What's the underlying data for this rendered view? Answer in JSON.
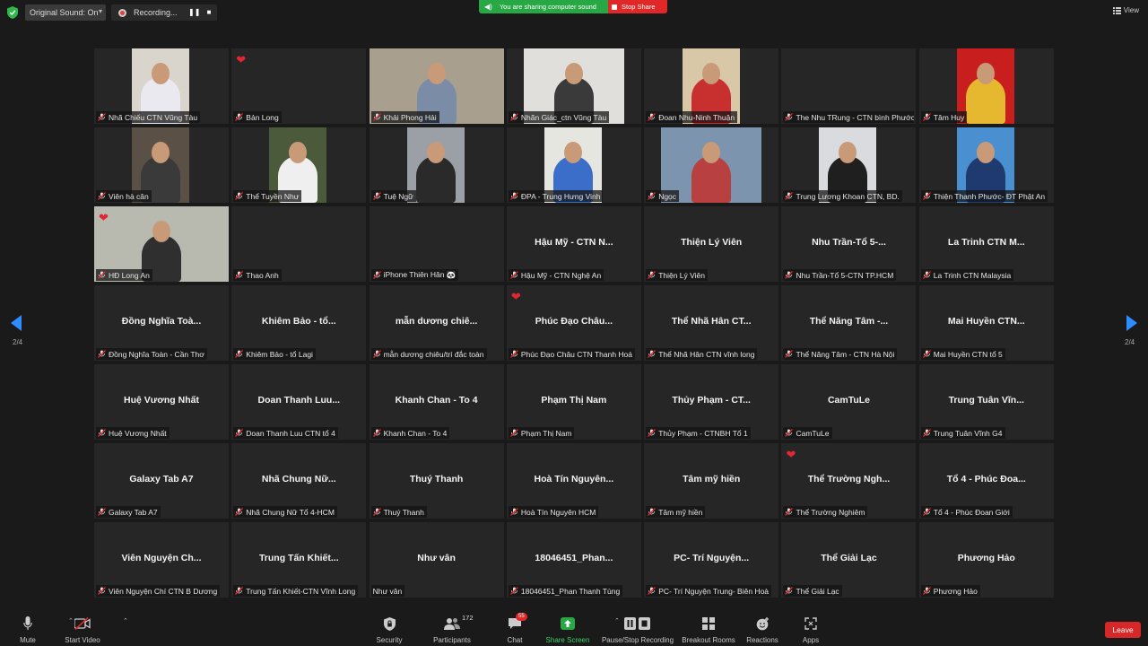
{
  "topbar": {
    "original_sound": "Original Sound: On",
    "recording": "Recording...",
    "sharing_banner": "You are sharing computer sound",
    "stop_share": "Stop Share",
    "view": "View"
  },
  "nav": {
    "page": "2/4"
  },
  "colors": {
    "accent_green": "#28a745",
    "danger_red": "#e02828",
    "heart": "#e32636",
    "tile_bg": "#262626"
  },
  "tiles": [
    {
      "label": "Nhã Chiếu CTN Vũng Tàu",
      "video": true,
      "vx": 42,
      "vw": 64,
      "bg": "#d9d4cc",
      "shirt": "#e9e9ef"
    },
    {
      "label": "Bản Long",
      "heart": true
    },
    {
      "label": "Khải Phong Hải",
      "video": true,
      "vx": 0,
      "vw": 150,
      "bg": "#a89f8e",
      "shirt": "#7a8ca6"
    },
    {
      "label": "Nhãn Giác_ctn Vũng Tàu",
      "video": true,
      "vx": 19,
      "vw": 112,
      "bg": "#e0dfdb",
      "shirt": "#3a3a3a"
    },
    {
      "label": "Đoan Nhu-Ninh Thuận",
      "video": true,
      "vx": 43,
      "vw": 64,
      "bg": "#d8c8a8",
      "shirt": "#c83030"
    },
    {
      "label": "The Nhu TRung - CTN bình Phước"
    },
    {
      "label": "Tâm Huy",
      "video": true,
      "vx": 42,
      "vw": 64,
      "bg": "#c81e1e",
      "shirt": "#e6b830"
    },
    {
      "label": "Viên hà cân",
      "video": true,
      "vx": 42,
      "vw": 64,
      "bg": "#5a5045",
      "shirt": "#3a3a3a"
    },
    {
      "label": "Thể Tuyền Như",
      "video": true,
      "vx": 42,
      "vw": 64,
      "bg": "#4a5a3a",
      "shirt": "#efefef"
    },
    {
      "label": "Tuệ Ngữ",
      "video": true,
      "vx": 42,
      "vw": 64,
      "bg": "#9aa0a6",
      "shirt": "#2a2a2a"
    },
    {
      "label": "ĐPA - Trung Hưng Vinh",
      "video": true,
      "vx": 42,
      "vw": 64,
      "bg": "#e6e6e0",
      "shirt": "#3a6ec8"
    },
    {
      "label": "Ngọc",
      "video": true,
      "vx": 19,
      "vw": 112,
      "bg": "#7c94ad",
      "shirt": "#b84040"
    },
    {
      "label": "Trung Lương Khoan CTN, BD.",
      "video": true,
      "vx": 42,
      "vw": 64,
      "bg": "#d9dbdf",
      "shirt": "#1f1f1f"
    },
    {
      "label": "Thiện Thanh Phước- ĐT Phật An",
      "video": true,
      "vx": 42,
      "vw": 64,
      "bg": "#4a8fd0",
      "shirt": "#1f3a6e"
    },
    {
      "label": "HĐ Long An",
      "heart": true,
      "video": true,
      "vx": 0,
      "vw": 150,
      "bg": "#b8bab0",
      "shirt": "#2f2f2f"
    },
    {
      "label": "Thao Anh"
    },
    {
      "label": "iPhone Thiên Hân 🐼"
    },
    {
      "display": "Hậu Mỹ - CTN N...",
      "label": "Hậu Mỹ - CTN Nghệ An"
    },
    {
      "display": "Thiện Lý Viên",
      "label": "Thiện Lý Viên"
    },
    {
      "display": "Nhu Trần-Tổ 5-...",
      "label": "Nhu Trần-Tổ 5-CTN TP.HCM"
    },
    {
      "display": "La Trinh CTN M...",
      "label": "La Trinh CTN Malaysia"
    },
    {
      "display": "Đồng Nghĩa Toà...",
      "label": "Đồng Nghĩa Toàn - Cần Thơ"
    },
    {
      "display": "Khiêm Bảo - tổ...",
      "label": "Khiêm Bảo - tổ Lagi"
    },
    {
      "display": "mẫn dương chiê...",
      "label": "mẫn dương chiêu/trí đắc toàn"
    },
    {
      "display": "Phúc Đạo Châu...",
      "label": "Phúc Đạo Châu CTN Thanh Hoá",
      "heart": true
    },
    {
      "display": "Thể Nhã Hân CT...",
      "label": "Thể Nhã Hân CTN vĩnh long"
    },
    {
      "display": "Thể Năng Tâm -...",
      "label": "Thể Năng Tâm - CTN Hà Nội"
    },
    {
      "display": "Mai Huyền CTN...",
      "label": "Mai Huyền CTN tổ 5"
    },
    {
      "display": "Huệ Vương Nhất",
      "label": "Huệ Vương Nhất"
    },
    {
      "display": "Doan Thanh Luu...",
      "label": "Doan Thanh Luu CTN tổ 4"
    },
    {
      "display": "Khanh Chan - To 4",
      "label": "Khanh Chan - To 4"
    },
    {
      "display": "Phạm Thị Nam",
      "label": "Phạm Thị Nam"
    },
    {
      "display": "Thủy Phạm - CT...",
      "label": "Thủy Phạm - CTNBH Tổ 1"
    },
    {
      "display": "CamTuLe",
      "label": "CamTuLe"
    },
    {
      "display": "Trung Tuân Vĩn...",
      "label": "Trung Tuân Vĩnh G4"
    },
    {
      "display": "Galaxy Tab A7",
      "label": "Galaxy Tab A7"
    },
    {
      "display": "Nhã Chung Nữ...",
      "label": "Nhã Chung Nữ Tổ 4-HCM"
    },
    {
      "display": "Thuý Thanh",
      "label": "Thuý Thanh"
    },
    {
      "display": "Hoà Tín Nguyên...",
      "label": "Hoà Tín Nguyên HCM"
    },
    {
      "display": "Tâm mỹ hiền",
      "label": "Tâm mỹ hiền"
    },
    {
      "display": "Thể Trường Ngh...",
      "label": "Thể Trường Nghiêm",
      "heart": true
    },
    {
      "display": "Tổ 4 - Phúc Đoa...",
      "label": "Tổ 4 - Phúc Đoan Giới"
    },
    {
      "display": "Viên Nguyện Ch...",
      "label": "Viên Nguyện Chí CTN B Dương"
    },
    {
      "display": "Trung Tấn Khiết...",
      "label": "Trung Tấn Khiết-CTN Vĩnh Long"
    },
    {
      "display": "Như vân",
      "label": "Như vân",
      "nomic": true
    },
    {
      "display": "18046451_Phan...",
      "label": "18046451_Phan Thanh Tùng"
    },
    {
      "display": "PC- Trí Nguyện...",
      "label": "PC- Trí Nguyện Trung- Biên Hoà"
    },
    {
      "display": "Thể Giải Lạc",
      "label": "Thể Giải Lạc"
    },
    {
      "display": "Phương Hảo",
      "label": "Phương Hảo"
    }
  ],
  "toolbar": {
    "mute": "Mute",
    "start_video": "Start Video",
    "security": "Security",
    "participants": "Participants",
    "participants_count": "172",
    "chat": "Chat",
    "chat_badge": "55",
    "share_screen": "Share Screen",
    "pause_recording": "Pause/Stop Recording",
    "breakout_rooms": "Breakout Rooms",
    "reactions": "Reactions",
    "apps": "Apps",
    "leave": "Leave"
  }
}
